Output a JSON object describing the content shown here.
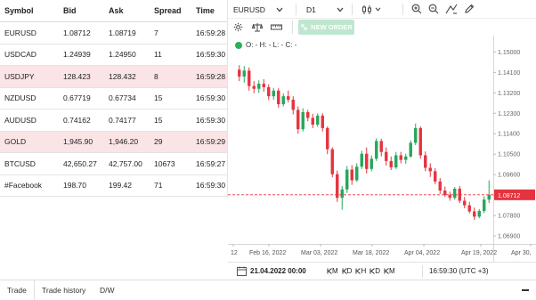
{
  "quotes": {
    "headers": {
      "symbol": "Symbol",
      "bid": "Bid",
      "ask": "Ask",
      "spread": "Spread",
      "time": "Time"
    },
    "rows": [
      {
        "symbol": "EURUSD",
        "bid": "1.08712",
        "ask": "1.08719",
        "spread": "7",
        "time": "16:59:28",
        "highlight": false
      },
      {
        "symbol": "USDCAD",
        "bid": "1.24939",
        "ask": "1.24950",
        "spread": "11",
        "time": "16:59:30",
        "highlight": false
      },
      {
        "symbol": "USDJPY",
        "bid": "128.423",
        "ask": "128.432",
        "spread": "8",
        "time": "16:59:28",
        "highlight": true
      },
      {
        "symbol": "NZDUSD",
        "bid": "0.67719",
        "ask": "0.67734",
        "spread": "15",
        "time": "16:59:30",
        "highlight": false
      },
      {
        "symbol": "AUDUSD",
        "bid": "0.74162",
        "ask": "0.74177",
        "spread": "15",
        "time": "16:59:30",
        "highlight": false
      },
      {
        "symbol": "GOLD",
        "bid": "1,945.90",
        "ask": "1,946.20",
        "spread": "29",
        "time": "16:59:29",
        "highlight": true
      },
      {
        "symbol": "BTCUSD",
        "bid": "42,650.27",
        "ask": "42,757.00",
        "spread": "10673",
        "time": "16:59:27",
        "highlight": false
      },
      {
        "symbol": "#Facebook",
        "bid": "198.70",
        "ask": "199.42",
        "spread": "71",
        "time": "16:59:30",
        "highlight": false
      }
    ]
  },
  "chart_toolbar": {
    "symbol": "EURUSD",
    "timeframe": "D1",
    "new_order_label": "NEW ORDER",
    "ohlc_text": "O: - H: - L: - C: -",
    "icons": [
      "candles-icon",
      "zoom-in-icon",
      "zoom-out-icon",
      "draw-tools-icon",
      "pencil-icon",
      "settings-icon",
      "scales-icon",
      "ruler-icon",
      "buy-sell-icon"
    ]
  },
  "chart_footer": {
    "date": "21.04.2022 00:00",
    "periods": [
      "M",
      "D",
      "H",
      "D",
      "M"
    ],
    "server_time": "16:59:30 (UTC +3)"
  },
  "tabs": [
    "Trade",
    "Trade history",
    "D/W"
  ],
  "colors": {
    "bull": "#26a65b",
    "bear": "#e5333f",
    "price_line": "#e5333f",
    "highlight_row": "#fbe4e6",
    "accent": "#26b35a"
  },
  "chart_data": {
    "type": "candlestick",
    "title": "",
    "y_ticks": [
      "1.15000",
      "1.14100",
      "1.13200",
      "1.12300",
      "1.11400",
      "1.10500",
      "1.09600",
      "1.08700",
      "1.07800",
      "1.06900"
    ],
    "x_ticks": [
      "12",
      "Feb 16, 2022",
      "Mar 03, 2022",
      "Mar 18, 2022",
      "Apr 04, 2022",
      "Apr 19, 2022",
      "Apr 30,"
    ],
    "ylim": [
      1.0655,
      1.1525
    ],
    "current_price": 1.08712,
    "current_price_label": "1.08712",
    "candles": [
      {
        "o": 1.1422,
        "h": 1.1442,
        "l": 1.1372,
        "c": 1.1392
      },
      {
        "o": 1.1392,
        "h": 1.1438,
        "l": 1.1365,
        "c": 1.1418
      },
      {
        "o": 1.1418,
        "h": 1.1432,
        "l": 1.133,
        "c": 1.135
      },
      {
        "o": 1.135,
        "h": 1.1372,
        "l": 1.1318,
        "c": 1.1338
      },
      {
        "o": 1.1338,
        "h": 1.1375,
        "l": 1.132,
        "c": 1.136
      },
      {
        "o": 1.136,
        "h": 1.138,
        "l": 1.1325,
        "c": 1.1345
      },
      {
        "o": 1.1345,
        "h": 1.1358,
        "l": 1.1288,
        "c": 1.1305
      },
      {
        "o": 1.1305,
        "h": 1.1342,
        "l": 1.129,
        "c": 1.133
      },
      {
        "o": 1.133,
        "h": 1.134,
        "l": 1.1255,
        "c": 1.127
      },
      {
        "o": 1.127,
        "h": 1.1318,
        "l": 1.126,
        "c": 1.1305
      },
      {
        "o": 1.1305,
        "h": 1.133,
        "l": 1.1278,
        "c": 1.129
      },
      {
        "o": 1.129,
        "h": 1.1305,
        "l": 1.1225,
        "c": 1.1245
      },
      {
        "o": 1.1245,
        "h": 1.126,
        "l": 1.114,
        "c": 1.116
      },
      {
        "o": 1.116,
        "h": 1.1252,
        "l": 1.115,
        "c": 1.1235
      },
      {
        "o": 1.1235,
        "h": 1.1245,
        "l": 1.1195,
        "c": 1.121
      },
      {
        "o": 1.121,
        "h": 1.1228,
        "l": 1.1165,
        "c": 1.118
      },
      {
        "o": 1.118,
        "h": 1.123,
        "l": 1.117,
        "c": 1.122
      },
      {
        "o": 1.122,
        "h": 1.123,
        "l": 1.115,
        "c": 1.1165
      },
      {
        "o": 1.1165,
        "h": 1.1172,
        "l": 1.105,
        "c": 1.1072
      },
      {
        "o": 1.1072,
        "h": 1.108,
        "l": 1.0948,
        "c": 1.0962
      },
      {
        "o": 1.0962,
        "h": 1.0978,
        "l": 1.084,
        "c": 1.0858
      },
      {
        "o": 1.0858,
        "h": 1.091,
        "l": 1.0805,
        "c": 1.0895
      },
      {
        "o": 1.0895,
        "h": 1.0998,
        "l": 1.088,
        "c": 1.0982
      },
      {
        "o": 1.0982,
        "h": 1.1002,
        "l": 1.0915,
        "c": 1.0935
      },
      {
        "o": 1.0935,
        "h": 1.101,
        "l": 1.0928,
        "c": 1.0995
      },
      {
        "o": 1.0995,
        "h": 1.1065,
        "l": 1.0985,
        "c": 1.1052
      },
      {
        "o": 1.1052,
        "h": 1.108,
        "l": 1.0965,
        "c": 1.0985
      },
      {
        "o": 1.0985,
        "h": 1.1045,
        "l": 1.0975,
        "c": 1.103
      },
      {
        "o": 1.103,
        "h": 1.112,
        "l": 1.102,
        "c": 1.1108
      },
      {
        "o": 1.1108,
        "h": 1.1118,
        "l": 1.104,
        "c": 1.106
      },
      {
        "o": 1.106,
        "h": 1.108,
        "l": 1.1,
        "c": 1.102
      },
      {
        "o": 1.102,
        "h": 1.104,
        "l": 1.098,
        "c": 1.0992
      },
      {
        "o": 1.0992,
        "h": 1.106,
        "l": 1.0985,
        "c": 1.1045
      },
      {
        "o": 1.1045,
        "h": 1.106,
        "l": 1.101,
        "c": 1.1025
      },
      {
        "o": 1.1025,
        "h": 1.1052,
        "l": 1.1008,
        "c": 1.104
      },
      {
        "o": 1.104,
        "h": 1.111,
        "l": 1.1035,
        "c": 1.11
      },
      {
        "o": 1.11,
        "h": 1.1185,
        "l": 1.109,
        "c": 1.1165
      },
      {
        "o": 1.1165,
        "h": 1.1172,
        "l": 1.103,
        "c": 1.1045
      },
      {
        "o": 1.1045,
        "h": 1.1062,
        "l": 1.0975,
        "c": 1.099
      },
      {
        "o": 1.099,
        "h": 1.101,
        "l": 1.095,
        "c": 1.0975
      },
      {
        "o": 1.0975,
        "h": 1.0988,
        "l": 1.0918,
        "c": 1.093
      },
      {
        "o": 1.093,
        "h": 1.0945,
        "l": 1.0875,
        "c": 1.089
      },
      {
        "o": 1.089,
        "h": 1.0908,
        "l": 1.0862,
        "c": 1.087
      },
      {
        "o": 1.087,
        "h": 1.0885,
        "l": 1.0845,
        "c": 1.0858
      },
      {
        "o": 1.0858,
        "h": 1.0905,
        "l": 1.085,
        "c": 1.0898
      },
      {
        "o": 1.0898,
        "h": 1.091,
        "l": 1.0835,
        "c": 1.0845
      },
      {
        "o": 1.0845,
        "h": 1.0862,
        "l": 1.0812,
        "c": 1.0825
      },
      {
        "o": 1.0825,
        "h": 1.084,
        "l": 1.079,
        "c": 1.0798
      },
      {
        "o": 1.0798,
        "h": 1.0815,
        "l": 1.076,
        "c": 1.0775
      },
      {
        "o": 1.0775,
        "h": 1.0808,
        "l": 1.0768,
        "c": 1.08
      },
      {
        "o": 1.08,
        "h": 1.0865,
        "l": 1.079,
        "c": 1.085
      },
      {
        "o": 1.085,
        "h": 1.0935,
        "l": 1.0835,
        "c": 1.0871
      }
    ]
  }
}
